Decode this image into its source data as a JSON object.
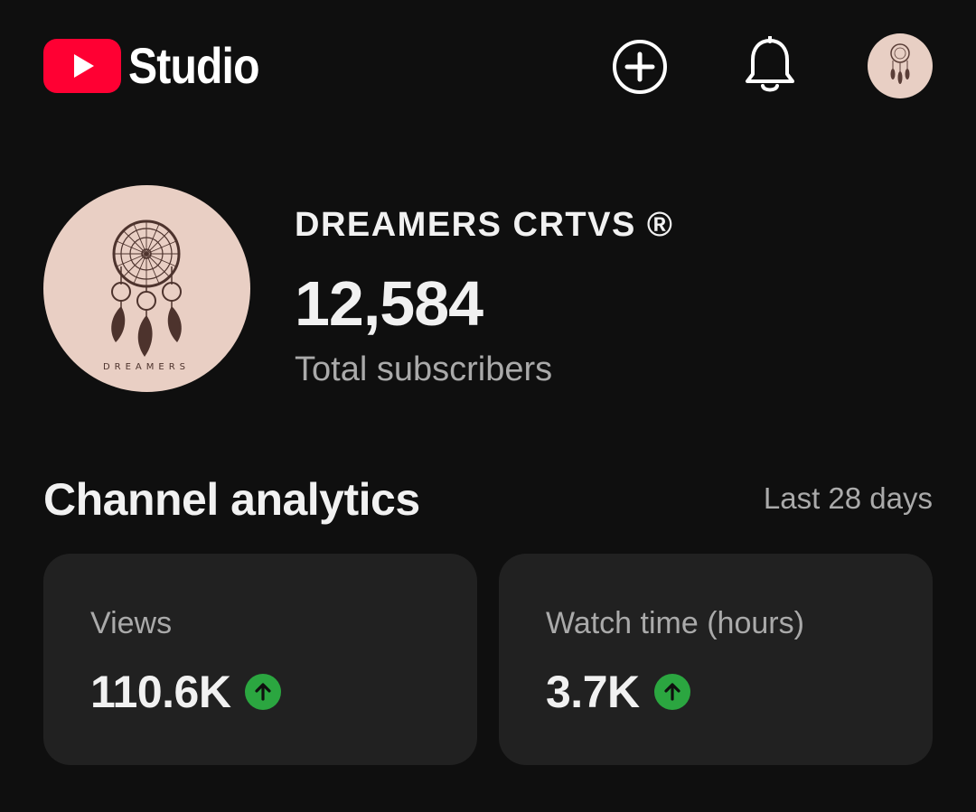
{
  "header": {
    "app_name": "Studio",
    "icons": {
      "logo": "youtube-play-icon",
      "create": "plus-circle-icon",
      "notifications": "bell-icon",
      "account": "account-avatar"
    }
  },
  "channel": {
    "name": "DREAMERS CRTVS ®",
    "subscriber_count": "12,584",
    "subscriber_label": "Total subscribers",
    "avatar_text": "DREAMERS"
  },
  "analytics": {
    "title": "Channel analytics",
    "range": "Last 28 days",
    "cards": [
      {
        "label": "Views",
        "value": "110.6K",
        "trend": "up"
      },
      {
        "label": "Watch time (hours)",
        "value": "3.7K",
        "trend": "up"
      }
    ]
  },
  "colors": {
    "background": "#0f0f0f",
    "card": "#212121",
    "brand_red": "#ff0033",
    "trend_green": "#2ba640",
    "secondary_text": "#aaaaaa"
  }
}
